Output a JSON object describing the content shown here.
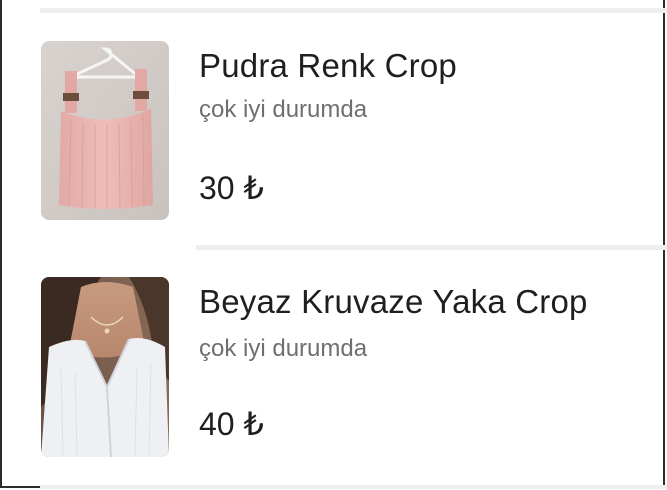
{
  "listings": [
    {
      "title": "Pudra Renk Crop",
      "condition": "çok iyi durumda",
      "price": "30 ₺",
      "image": "pink-crop-top-on-hanger"
    },
    {
      "title": "Beyaz Kruvaze Yaka Crop",
      "condition": "çok iyi durumda",
      "price": "40 ₺",
      "image": "white-wrap-crop-top-worn"
    }
  ],
  "colors": {
    "title": "#1f1f1f",
    "subtitle": "#6f6f6f",
    "divider": "#eeeeee"
  }
}
